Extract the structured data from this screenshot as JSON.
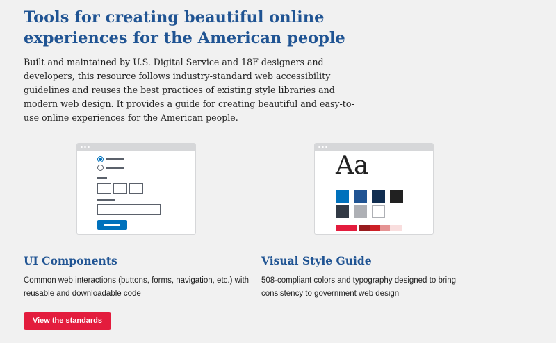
{
  "hero": {
    "title": "Tools for creating beautiful online experiences for the American people",
    "text": "Built and maintained by U.S. Digital Service and 18F designers and developers, this resource follows industry-standard web accessibility guidelines and reuses the best practices of existing style libraries and modern web design. It provides a guide for creating beautiful and easy-to-use online experiences for the American people."
  },
  "ui_components": {
    "title": "UI Components",
    "text": "Common web interactions (buttons, forms, navigation, etc.) with reusable and downloadable code"
  },
  "style_guide": {
    "title": "Visual Style Guide",
    "text": "508-compliant colors and typography designed to bring consistency to government web design",
    "sample_glyph": "Aa"
  },
  "cta": {
    "label": "View the standards"
  },
  "colors": {
    "primary_blue": "#0071bc",
    "dark_blue": "#205493",
    "darkest_blue": "#112e51",
    "red": "#e31c3d",
    "text": "#212121"
  }
}
